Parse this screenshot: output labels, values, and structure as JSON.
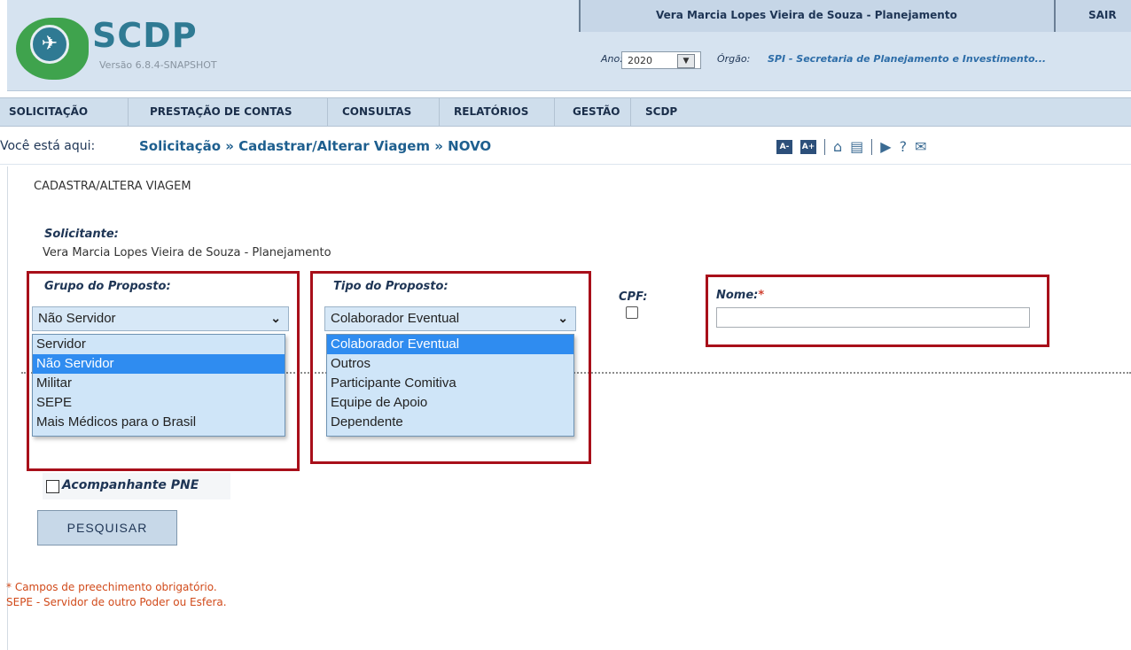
{
  "app": {
    "logo_text": "SCDP",
    "version": "Versão 6.8.4-SNAPSHOT"
  },
  "user_bar": {
    "user": "Vera Marcia Lopes Vieira de Souza - Planejamento",
    "logout": "SAIR"
  },
  "filters": {
    "ano_label": "Ano:",
    "ano_value": "2020",
    "orgao_label": "Órgão:",
    "orgao_value": "SPI - Secretaria de Planejamento e Investimento..."
  },
  "menu": [
    "SOLICITAÇÃO",
    "PRESTAÇÃO DE CONTAS",
    "CONSULTAS",
    "RELATÓRIOS",
    "GESTÃO",
    "SCDP"
  ],
  "breadcrumb": {
    "label": "Você está aqui:",
    "path": "Solicitação » Cadastrar/Alterar Viagem » NOVO"
  },
  "tools": {
    "font_decrease": "A-",
    "font_increase": "A+"
  },
  "form": {
    "title": "CADASTRA/ALTERA VIAGEM",
    "solicitante_label": "Solicitante:",
    "solicitante_value": "Vera Marcia Lopes Vieira de Souza - Planejamento",
    "grupo_label": "Grupo do Proposto:",
    "grupo_selected": "Não Servidor",
    "grupo_options": [
      "Servidor",
      "Não Servidor",
      "Militar",
      "SEPE",
      "Mais Médicos para o Brasil"
    ],
    "tipo_label": "Tipo do Proposto:",
    "tipo_selected": "Colaborador Eventual",
    "tipo_options": [
      "Colaborador Eventual",
      "Outros",
      "Participante Comitiva",
      "Equipe de Apoio",
      "Dependente"
    ],
    "cpf_label": "CPF:",
    "nome_label": "Nome:",
    "nome_required": "*",
    "nome_value": "",
    "pne_label": "Acompanhante PNE",
    "search_button": "PESQUISAR"
  },
  "notes": {
    "required": "* Campos de preechimento obrigatório.",
    "sepe": "SEPE - Servidor de outro Poder ou Esfera."
  },
  "colors": {
    "highlight": "#a80f1a",
    "selected_option": "#2f8cf0",
    "menu_bg": "#cfdeec"
  }
}
